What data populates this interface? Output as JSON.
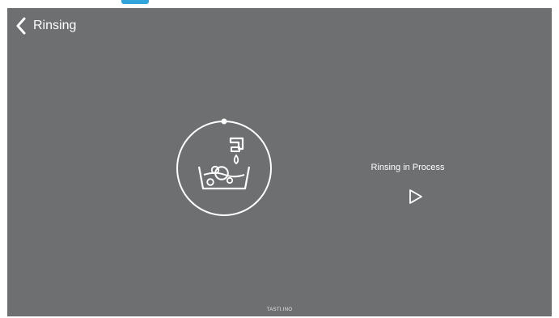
{
  "header": {
    "back_icon": "chevron-left-icon",
    "title": "Rinsing"
  },
  "main": {
    "dial_icon": "rinse-faucet-basin-icon",
    "status": "Rinsing in Process",
    "play_icon": "play-icon"
  },
  "footer": {
    "brand": "TASTI.INO"
  },
  "colors": {
    "screen_background": "#6e6f71",
    "foreground": "#ffffff",
    "page_background": "#ffffff",
    "cutoff_accent": "#1a9bd8"
  }
}
